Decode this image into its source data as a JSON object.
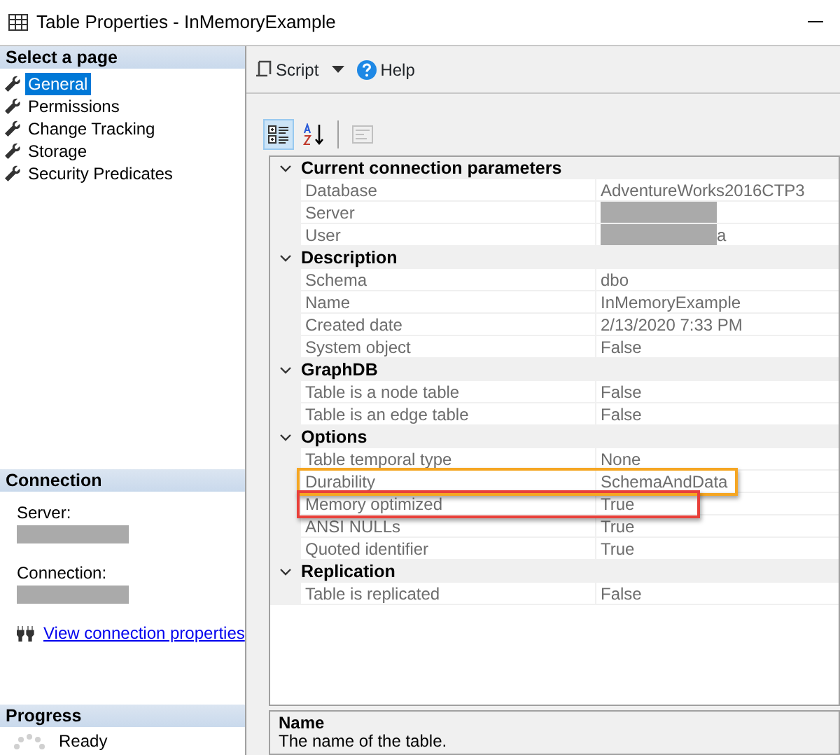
{
  "window": {
    "title": "Table Properties - InMemoryExample"
  },
  "select_page": {
    "header": "Select a page",
    "items": [
      {
        "label": "General",
        "selected": true
      },
      {
        "label": "Permissions",
        "selected": false
      },
      {
        "label": "Change Tracking",
        "selected": false
      },
      {
        "label": "Storage",
        "selected": false
      },
      {
        "label": "Security Predicates",
        "selected": false
      }
    ]
  },
  "connection": {
    "header": "Connection",
    "fields": [
      {
        "label": "Server:",
        "redacted": true
      },
      {
        "label": "Connection:",
        "redacted": true
      }
    ],
    "link": "View connection properties"
  },
  "progress": {
    "header": "Progress",
    "status": "Ready"
  },
  "toolbar": {
    "script": "Script",
    "help": "Help"
  },
  "grid_toolbar": [
    {
      "kind": "categorized",
      "selected": true,
      "disabled": false
    },
    {
      "kind": "alphabetical",
      "selected": false,
      "disabled": false
    },
    {
      "kind": "property_pages",
      "selected": false,
      "disabled": true
    }
  ],
  "categories": [
    {
      "name": "Current connection parameters",
      "expanded": true,
      "rows": [
        {
          "name": "Database",
          "value": "AdventureWorks2016CTP3"
        },
        {
          "name": "Server",
          "redacted": true
        },
        {
          "name": "User",
          "value": "a",
          "redacted": true
        }
      ]
    },
    {
      "name": "Description",
      "expanded": true,
      "rows": [
        {
          "name": "Schema",
          "value": "dbo"
        },
        {
          "name": "Name",
          "value": "InMemoryExample"
        },
        {
          "name": "Created date",
          "value": "2/13/2020 7:33 PM"
        },
        {
          "name": "System object",
          "value": "False"
        }
      ]
    },
    {
      "name": "GraphDB",
      "expanded": true,
      "rows": [
        {
          "name": "Table is a node table",
          "value": "False"
        },
        {
          "name": "Table is an edge table",
          "value": "False"
        }
      ]
    },
    {
      "name": "Options",
      "expanded": true,
      "rows": [
        {
          "name": "Table temporal type",
          "value": "None"
        },
        {
          "name": "Durability",
          "value": "SchemaAndData",
          "color": "#f5a623"
        },
        {
          "name": "Memory optimized",
          "value": "True",
          "color": "#e8403a"
        },
        {
          "name": "ANSI NULLs",
          "value": "True"
        },
        {
          "name": "Quoted identifier",
          "value": "True"
        }
      ]
    },
    {
      "name": "Replication",
      "expanded": true,
      "rows": [
        {
          "name": "Table is replicated",
          "value": "False"
        }
      ]
    }
  ],
  "description_pane": {
    "title": "Name",
    "text": "The name of the table."
  }
}
